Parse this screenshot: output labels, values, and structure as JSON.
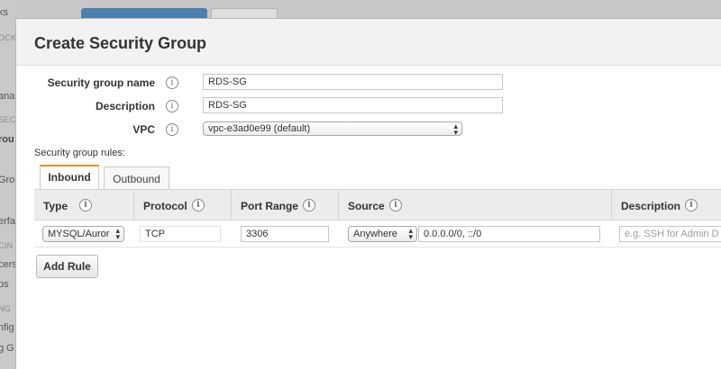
{
  "background": {
    "sidebar_fragments": [
      "ks",
      "OCK",
      "ana",
      "SEC",
      "rou",
      "Gro",
      "erfa",
      "CIN",
      "cers",
      "ps",
      "NG",
      "nfig",
      "g G"
    ]
  },
  "modal": {
    "title": "Create Security Group",
    "fields": {
      "name": {
        "label": "Security group name",
        "value": "RDS-SG"
      },
      "description": {
        "label": "Description",
        "value": "RDS-SG"
      },
      "vpc": {
        "label": "VPC",
        "value": "vpc-e3ad0e99 (default)"
      }
    },
    "info_glyph": "i",
    "rules_label": "Security group rules:",
    "tabs": {
      "inbound": "Inbound",
      "outbound": "Outbound",
      "active": "Inbound"
    },
    "table": {
      "headers": {
        "type": "Type",
        "protocol": "Protocol",
        "port_range": "Port Range",
        "source": "Source",
        "description": "Description"
      },
      "rows": [
        {
          "type": "MYSQL/Auror",
          "protocol": "TCP",
          "port_range": "3306",
          "source_select": "Anywhere",
          "source_value": "0.0.0.0/0, ::/0",
          "description_placeholder": "e.g. SSH for Admin D"
        }
      ]
    },
    "add_rule_label": "Add Rule"
  },
  "colors": {
    "active_tab_accent": "#e48f1a",
    "header_bg": "#f2f2f2",
    "overlay": "#c7c7c7"
  }
}
